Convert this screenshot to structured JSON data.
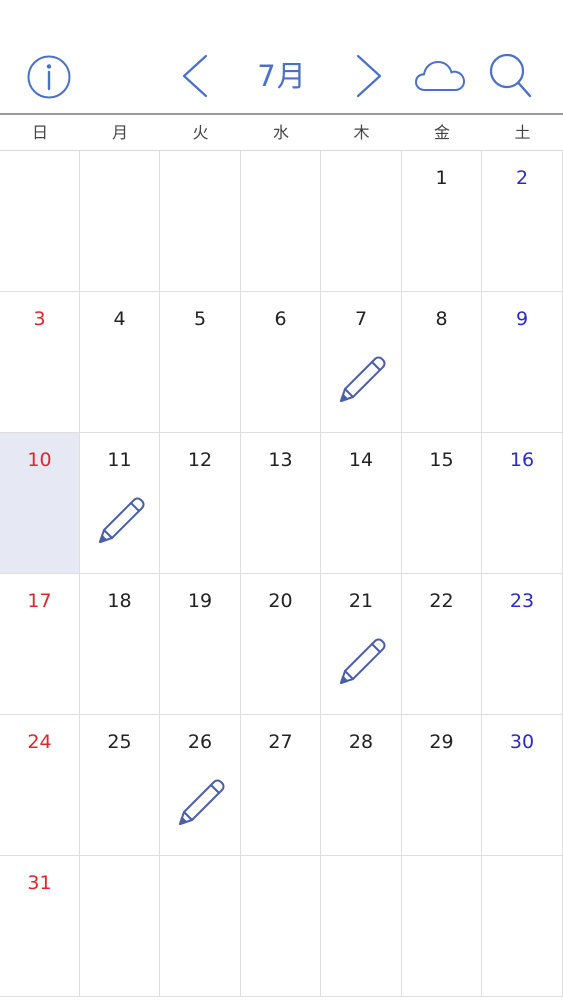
{
  "header": {
    "month_title": "7月",
    "icons": {
      "info": "info-circle-icon",
      "prev": "chevron-left-icon",
      "next": "chevron-right-icon",
      "cloud": "cloud-icon",
      "search": "search-icon"
    }
  },
  "weekdays": [
    "日",
    "月",
    "火",
    "水",
    "木",
    "金",
    "土"
  ],
  "colors": {
    "accent": "#4a70c8",
    "sunday": "#e0262c",
    "saturday": "#2a2ac8",
    "weekday": "#222222",
    "today_bg": "#e6e8f3",
    "memo_icon": "#4a5fa8"
  },
  "calendar": {
    "first_weekday_index": 5,
    "days_in_month": 31,
    "highlighted_day": 10,
    "memo_days": [
      7,
      11,
      21,
      26
    ]
  }
}
